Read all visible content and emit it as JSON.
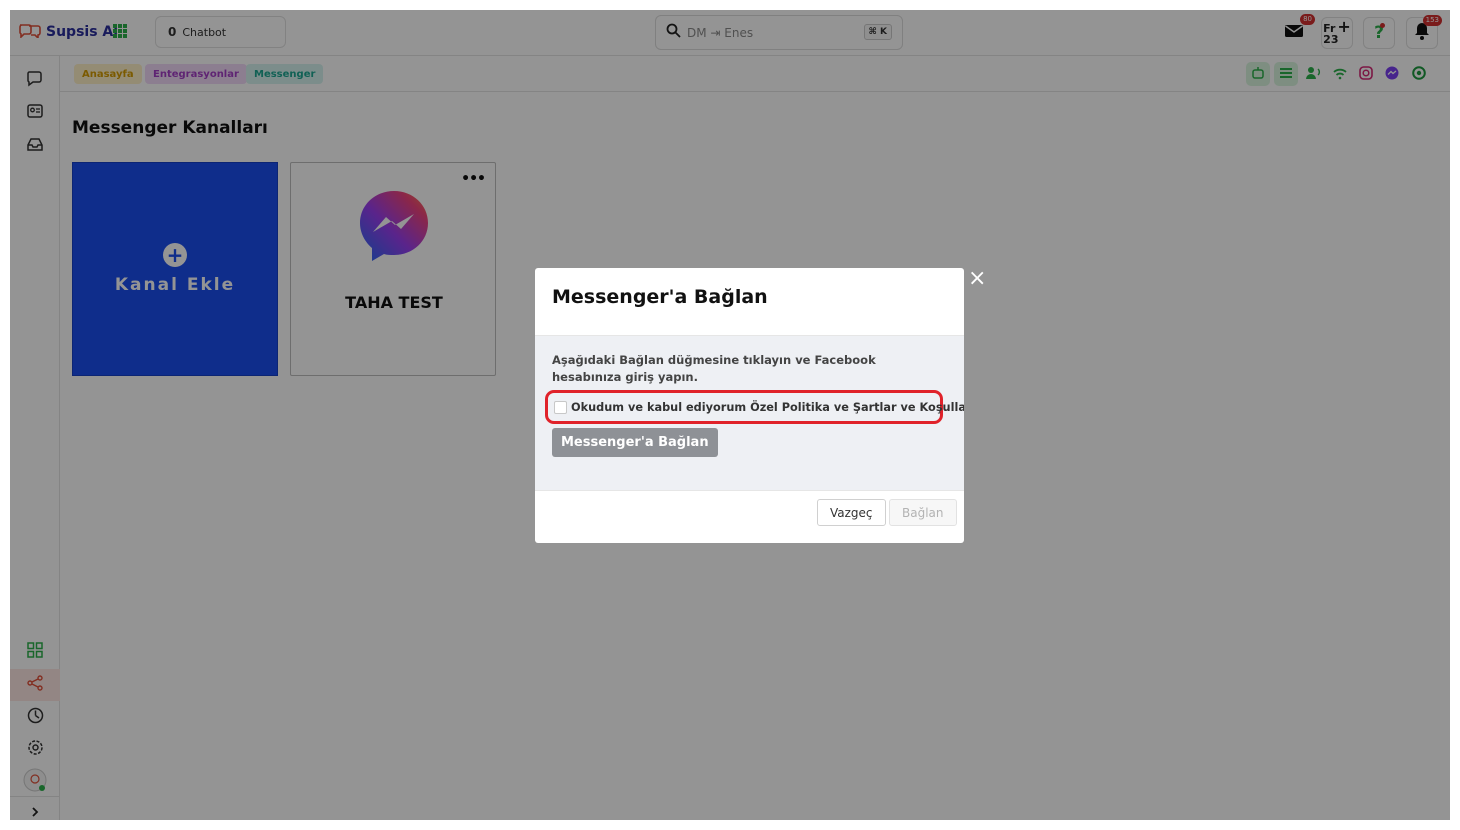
{
  "app": {
    "brand": "Supsis Ai"
  },
  "header": {
    "chatbot_count": "0",
    "chatbot_label": "Chatbot",
    "search_placeholder": "DM ⇥ Enes",
    "search_shortcut": "⌘ K",
    "mail_badge": "80",
    "date_day": "Fr",
    "date_num": "23",
    "notif_badge": "153"
  },
  "breadcrumb": [
    "Anasayfa",
    "Entegrasyonlar",
    "Messenger"
  ],
  "main": {
    "title": "Messenger Kanalları",
    "add_card_label": "Kanal Ekle",
    "channel_name": "TAHA TEST",
    "channel_menu": "•••"
  },
  "modal": {
    "title": "Messenger'a Bağlan",
    "description": "Aşağıdaki Bağlan düğmesine tıklayın ve Facebook hesabınıza giriş yapın.",
    "consent_text": "Okudum ve kabul ediyorum Özel Politika ve Şartlar ve Koşullar",
    "connect_messenger_label": "Messenger'a Bağlan",
    "cancel_label": "Vazgeç",
    "connect_label": "Bağlan"
  },
  "colors": {
    "accent_blue": "#1b4ef0",
    "highlight_red": "#e0222a",
    "brand_navy": "#2b2f9e"
  },
  "icons": [
    "chat-icon",
    "contact-card-icon",
    "inbox-icon",
    "grid-icon",
    "share-icon",
    "clock-icon",
    "settings-icon",
    "avatar",
    "chevron-right-icon"
  ]
}
